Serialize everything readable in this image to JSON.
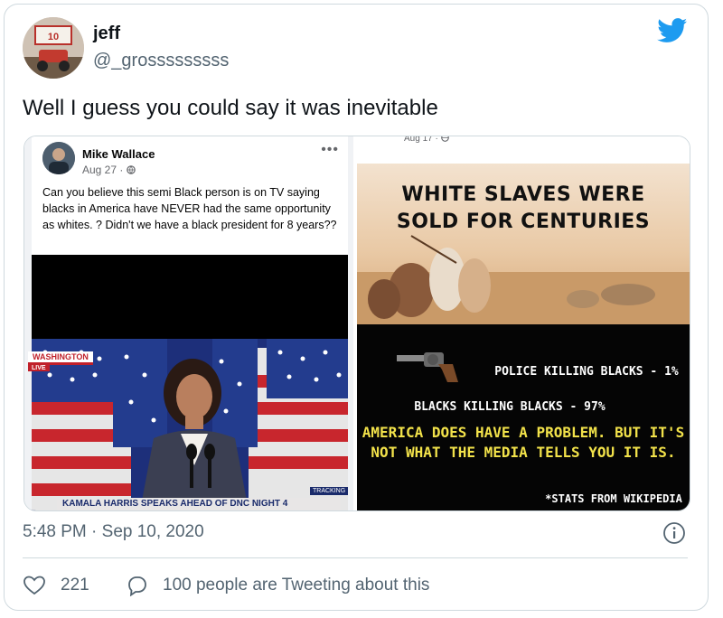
{
  "user": {
    "name": "jeff",
    "handle": "@_grosssssssss",
    "avatar_sign_text": "10"
  },
  "tweet": {
    "text": "Well I guess you could say it was inevitable",
    "timestamp": "5:48 PM · Sep 10, 2020",
    "likes": "221",
    "talking": "100 people are Tweeting about this"
  },
  "fb_post": {
    "author": "Mike Wallace",
    "date": "Aug 27 · ",
    "menu": "•••",
    "text": "Can you believe this semi Black person is on TV saying blacks in America have NEVER had the same opportunity as whites. ? Didn't we have a black president for 8 years??",
    "news_location": "WASHINGTON",
    "news_live": "LIVE",
    "chyron": "KAMALA HARRIS SPEAKS AHEAD OF DNC NIGHT 4",
    "tracking": "TRACKING"
  },
  "right_post": {
    "date": "Aug 17 · ",
    "meme_title_line1": "WHITE SLAVES WERE",
    "meme_title_line2": "SOLD FOR CENTURIES",
    "stat1": "POLICE KILLING BLACKS - 1%",
    "stat2": "BLACKS KILLING BLACKS - 97%",
    "claim_line1": "AMERICA DOES HAVE A PROBLEM. BUT IT'S",
    "claim_line2": "NOT WHAT THE MEDIA TELLS YOU IT IS.",
    "source": "*STATS FROM WIKIPEDIA"
  },
  "colors": {
    "twitter_blue": "#1d9bf0",
    "meme_yellow": "#f2e24a",
    "muted_text": "#536471"
  },
  "icons": [
    "twitter-bird-icon",
    "globe-icon",
    "info-icon",
    "heart-icon",
    "speech-bubble-icon",
    "revolver-icon"
  ]
}
